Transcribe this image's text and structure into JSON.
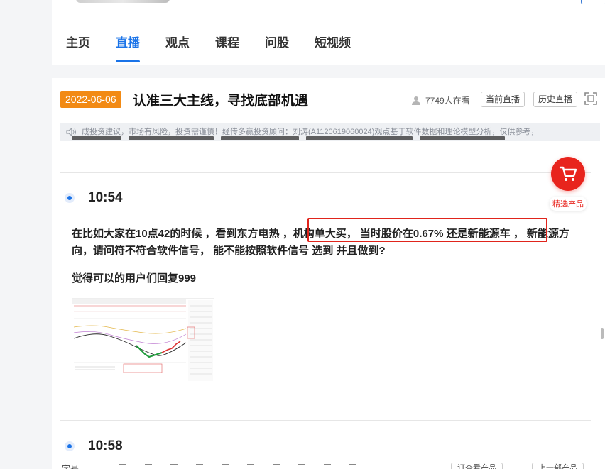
{
  "nav": {
    "items": [
      {
        "label": "主页",
        "active": false
      },
      {
        "label": "直播",
        "active": true
      },
      {
        "label": "观点",
        "active": false
      },
      {
        "label": "课程",
        "active": false
      },
      {
        "label": "问股",
        "active": false
      },
      {
        "label": "短视频",
        "active": false
      }
    ]
  },
  "live": {
    "date": "2022-06-06",
    "title": "认准三大主线，寻找底部机遇",
    "viewers": "7749人在看",
    "btn_current": "当前直播",
    "btn_history": "历史直播"
  },
  "notice": {
    "text": "成投资建议，市场有风险，投资需谨慎！经传多赢投资顾问：刘涛(A1120619060024)观点基于软件数据和理论模型分析，仅供参考，"
  },
  "entries": [
    {
      "time": "10:54",
      "para1": "在比如大家在10点42的时候 ，看到东方电热 ，机构单大买， 当时股价在0.67% 还是新能源车 ， 新能源方向，请问符不符合软件信号， 能不能按照软件信号 选到 并且做到?",
      "para2": "觉得可以的用户们回复999"
    },
    {
      "time": "10:58"
    }
  ],
  "cart": {
    "label": "精选产品",
    "icon": "shopping-cart-icon",
    "color": "#e8241d"
  },
  "colors": {
    "accent": "#1a73e8",
    "date_badge": "#f28a14",
    "highlight": "#e0241b"
  },
  "toolbar": {
    "label": "字号",
    "btn_left": "订查看产品",
    "btn_right": "上一部产品"
  }
}
